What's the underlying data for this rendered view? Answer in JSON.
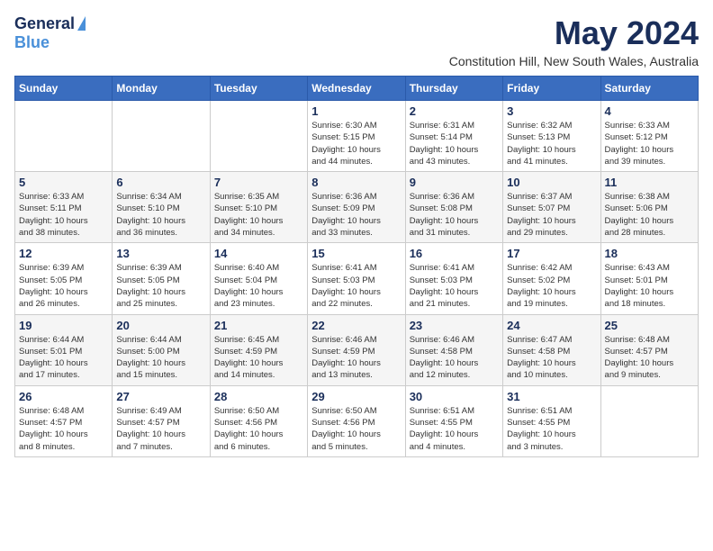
{
  "logo": {
    "general": "General",
    "blue": "Blue"
  },
  "title": "May 2024",
  "location": "Constitution Hill, New South Wales, Australia",
  "days_header": [
    "Sunday",
    "Monday",
    "Tuesday",
    "Wednesday",
    "Thursday",
    "Friday",
    "Saturday"
  ],
  "weeks": [
    [
      {
        "day": "",
        "info": ""
      },
      {
        "day": "",
        "info": ""
      },
      {
        "day": "",
        "info": ""
      },
      {
        "day": "1",
        "info": "Sunrise: 6:30 AM\nSunset: 5:15 PM\nDaylight: 10 hours\nand 44 minutes."
      },
      {
        "day": "2",
        "info": "Sunrise: 6:31 AM\nSunset: 5:14 PM\nDaylight: 10 hours\nand 43 minutes."
      },
      {
        "day": "3",
        "info": "Sunrise: 6:32 AM\nSunset: 5:13 PM\nDaylight: 10 hours\nand 41 minutes."
      },
      {
        "day": "4",
        "info": "Sunrise: 6:33 AM\nSunset: 5:12 PM\nDaylight: 10 hours\nand 39 minutes."
      }
    ],
    [
      {
        "day": "5",
        "info": "Sunrise: 6:33 AM\nSunset: 5:11 PM\nDaylight: 10 hours\nand 38 minutes."
      },
      {
        "day": "6",
        "info": "Sunrise: 6:34 AM\nSunset: 5:10 PM\nDaylight: 10 hours\nand 36 minutes."
      },
      {
        "day": "7",
        "info": "Sunrise: 6:35 AM\nSunset: 5:10 PM\nDaylight: 10 hours\nand 34 minutes."
      },
      {
        "day": "8",
        "info": "Sunrise: 6:36 AM\nSunset: 5:09 PM\nDaylight: 10 hours\nand 33 minutes."
      },
      {
        "day": "9",
        "info": "Sunrise: 6:36 AM\nSunset: 5:08 PM\nDaylight: 10 hours\nand 31 minutes."
      },
      {
        "day": "10",
        "info": "Sunrise: 6:37 AM\nSunset: 5:07 PM\nDaylight: 10 hours\nand 29 minutes."
      },
      {
        "day": "11",
        "info": "Sunrise: 6:38 AM\nSunset: 5:06 PM\nDaylight: 10 hours\nand 28 minutes."
      }
    ],
    [
      {
        "day": "12",
        "info": "Sunrise: 6:39 AM\nSunset: 5:05 PM\nDaylight: 10 hours\nand 26 minutes."
      },
      {
        "day": "13",
        "info": "Sunrise: 6:39 AM\nSunset: 5:05 PM\nDaylight: 10 hours\nand 25 minutes."
      },
      {
        "day": "14",
        "info": "Sunrise: 6:40 AM\nSunset: 5:04 PM\nDaylight: 10 hours\nand 23 minutes."
      },
      {
        "day": "15",
        "info": "Sunrise: 6:41 AM\nSunset: 5:03 PM\nDaylight: 10 hours\nand 22 minutes."
      },
      {
        "day": "16",
        "info": "Sunrise: 6:41 AM\nSunset: 5:03 PM\nDaylight: 10 hours\nand 21 minutes."
      },
      {
        "day": "17",
        "info": "Sunrise: 6:42 AM\nSunset: 5:02 PM\nDaylight: 10 hours\nand 19 minutes."
      },
      {
        "day": "18",
        "info": "Sunrise: 6:43 AM\nSunset: 5:01 PM\nDaylight: 10 hours\nand 18 minutes."
      }
    ],
    [
      {
        "day": "19",
        "info": "Sunrise: 6:44 AM\nSunset: 5:01 PM\nDaylight: 10 hours\nand 17 minutes."
      },
      {
        "day": "20",
        "info": "Sunrise: 6:44 AM\nSunset: 5:00 PM\nDaylight: 10 hours\nand 15 minutes."
      },
      {
        "day": "21",
        "info": "Sunrise: 6:45 AM\nSunset: 4:59 PM\nDaylight: 10 hours\nand 14 minutes."
      },
      {
        "day": "22",
        "info": "Sunrise: 6:46 AM\nSunset: 4:59 PM\nDaylight: 10 hours\nand 13 minutes."
      },
      {
        "day": "23",
        "info": "Sunrise: 6:46 AM\nSunset: 4:58 PM\nDaylight: 10 hours\nand 12 minutes."
      },
      {
        "day": "24",
        "info": "Sunrise: 6:47 AM\nSunset: 4:58 PM\nDaylight: 10 hours\nand 10 minutes."
      },
      {
        "day": "25",
        "info": "Sunrise: 6:48 AM\nSunset: 4:57 PM\nDaylight: 10 hours\nand 9 minutes."
      }
    ],
    [
      {
        "day": "26",
        "info": "Sunrise: 6:48 AM\nSunset: 4:57 PM\nDaylight: 10 hours\nand 8 minutes."
      },
      {
        "day": "27",
        "info": "Sunrise: 6:49 AM\nSunset: 4:57 PM\nDaylight: 10 hours\nand 7 minutes."
      },
      {
        "day": "28",
        "info": "Sunrise: 6:50 AM\nSunset: 4:56 PM\nDaylight: 10 hours\nand 6 minutes."
      },
      {
        "day": "29",
        "info": "Sunrise: 6:50 AM\nSunset: 4:56 PM\nDaylight: 10 hours\nand 5 minutes."
      },
      {
        "day": "30",
        "info": "Sunrise: 6:51 AM\nSunset: 4:55 PM\nDaylight: 10 hours\nand 4 minutes."
      },
      {
        "day": "31",
        "info": "Sunrise: 6:51 AM\nSunset: 4:55 PM\nDaylight: 10 hours\nand 3 minutes."
      },
      {
        "day": "",
        "info": ""
      }
    ]
  ]
}
